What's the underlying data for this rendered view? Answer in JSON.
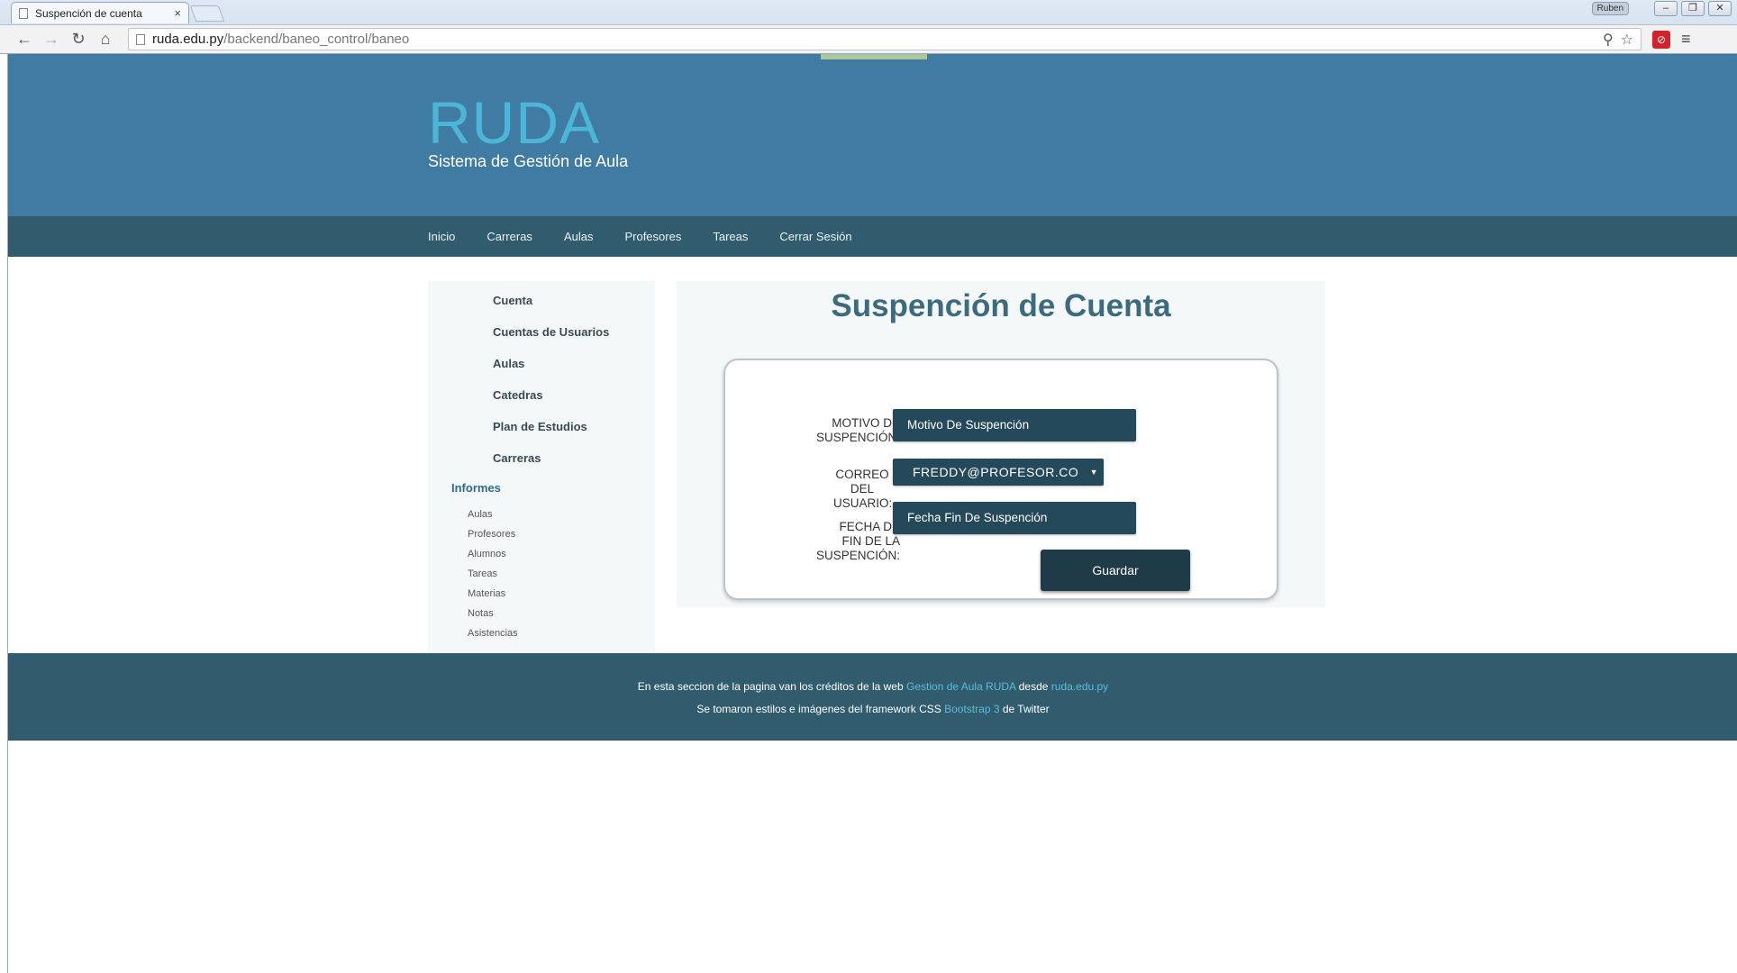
{
  "browser": {
    "tab_title": "Suspención de cuenta",
    "tab_close": "×",
    "user_badge": "Ruben",
    "url_host": "ruda.edu.py",
    "url_path": "/backend/baneo_control/baneo",
    "icons": [
      "back-icon",
      "forward-icon",
      "reload-icon",
      "home-icon",
      "search-icon",
      "star-icon",
      "extension-icon",
      "menu-icon"
    ]
  },
  "header": {
    "brand": "RUDA",
    "tagline": "Sistema de Gestión de Aula",
    "colors": {
      "header_bg": "#3f7ba3",
      "brand": "#4db6d8",
      "nav_bg": "#305c6d"
    }
  },
  "nav": {
    "items": [
      "Inicio",
      "Carreras",
      "Aulas",
      "Profesores",
      "Tareas",
      "Cerrar Sesión"
    ]
  },
  "sidebar": {
    "main_items": [
      "Cuenta",
      "Cuentas de Usuarios",
      "Aulas",
      "Catedras",
      "Plan de Estudios",
      "Carreras"
    ],
    "section_title": "Informes",
    "sub_items": [
      "Aulas",
      "Profesores",
      "Alumnos",
      "Tareas",
      "Materias",
      "Notas",
      "Asistencias"
    ]
  },
  "main": {
    "title": "Suspención de Cuenta",
    "form": {
      "motivo_label_1": "MOTIVO DE",
      "motivo_label_2": "SUSPENCIÓN:",
      "motivo_value": "Motivo De Suspención",
      "correo_label_1": "CORREO",
      "correo_label_2": "DEL",
      "correo_label_3": "USUARIO:",
      "correo_selected": "FREDDY@PROFESOR.CO",
      "fecha_label_1": "FECHA DE",
      "fecha_label_2": "FIN DE LA",
      "fecha_label_3": "SUSPENCIÓN:",
      "fecha_value": "Fecha Fin De Suspención",
      "save_label": "Guardar"
    }
  },
  "footer": {
    "line1_text": "En esta seccion de la pagina van los créditos de la web",
    "line1_link1": "Gestion de Aula RUDA",
    "line1_mid": "desde",
    "line1_link2": "ruda.edu.py",
    "line2_text": "Se tomaron estilos e imágenes del framework CSS",
    "line2_link": "Bootstrap 3",
    "line2_end": "de Twitter"
  }
}
